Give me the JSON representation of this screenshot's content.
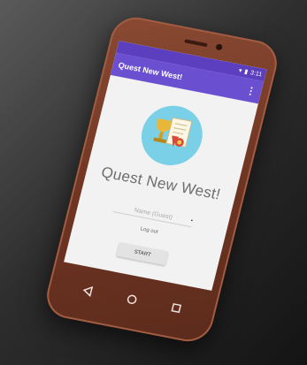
{
  "statusbar": {
    "time": "3:11",
    "icons": [
      "wifi-icon",
      "battery-icon"
    ]
  },
  "appbar": {
    "title": "Quest New West!",
    "menu_icon": "more-vert-icon",
    "color": "#6a4fd1",
    "statusbar_color": "#5b3fbe"
  },
  "main": {
    "logo_icon": "quest-logo-icon",
    "app_name": "Quest New West!",
    "name_input": {
      "placeholder": "Name (Guest)",
      "value": ""
    },
    "logout_label": "Log out",
    "start_label": "START"
  },
  "navbar": {
    "icons": [
      "back-icon",
      "home-icon",
      "recents-icon"
    ]
  },
  "colors": {
    "phone_body": "#7a3d28",
    "logo_bg": "#7ad0e6",
    "background": "#2e2e2e"
  }
}
